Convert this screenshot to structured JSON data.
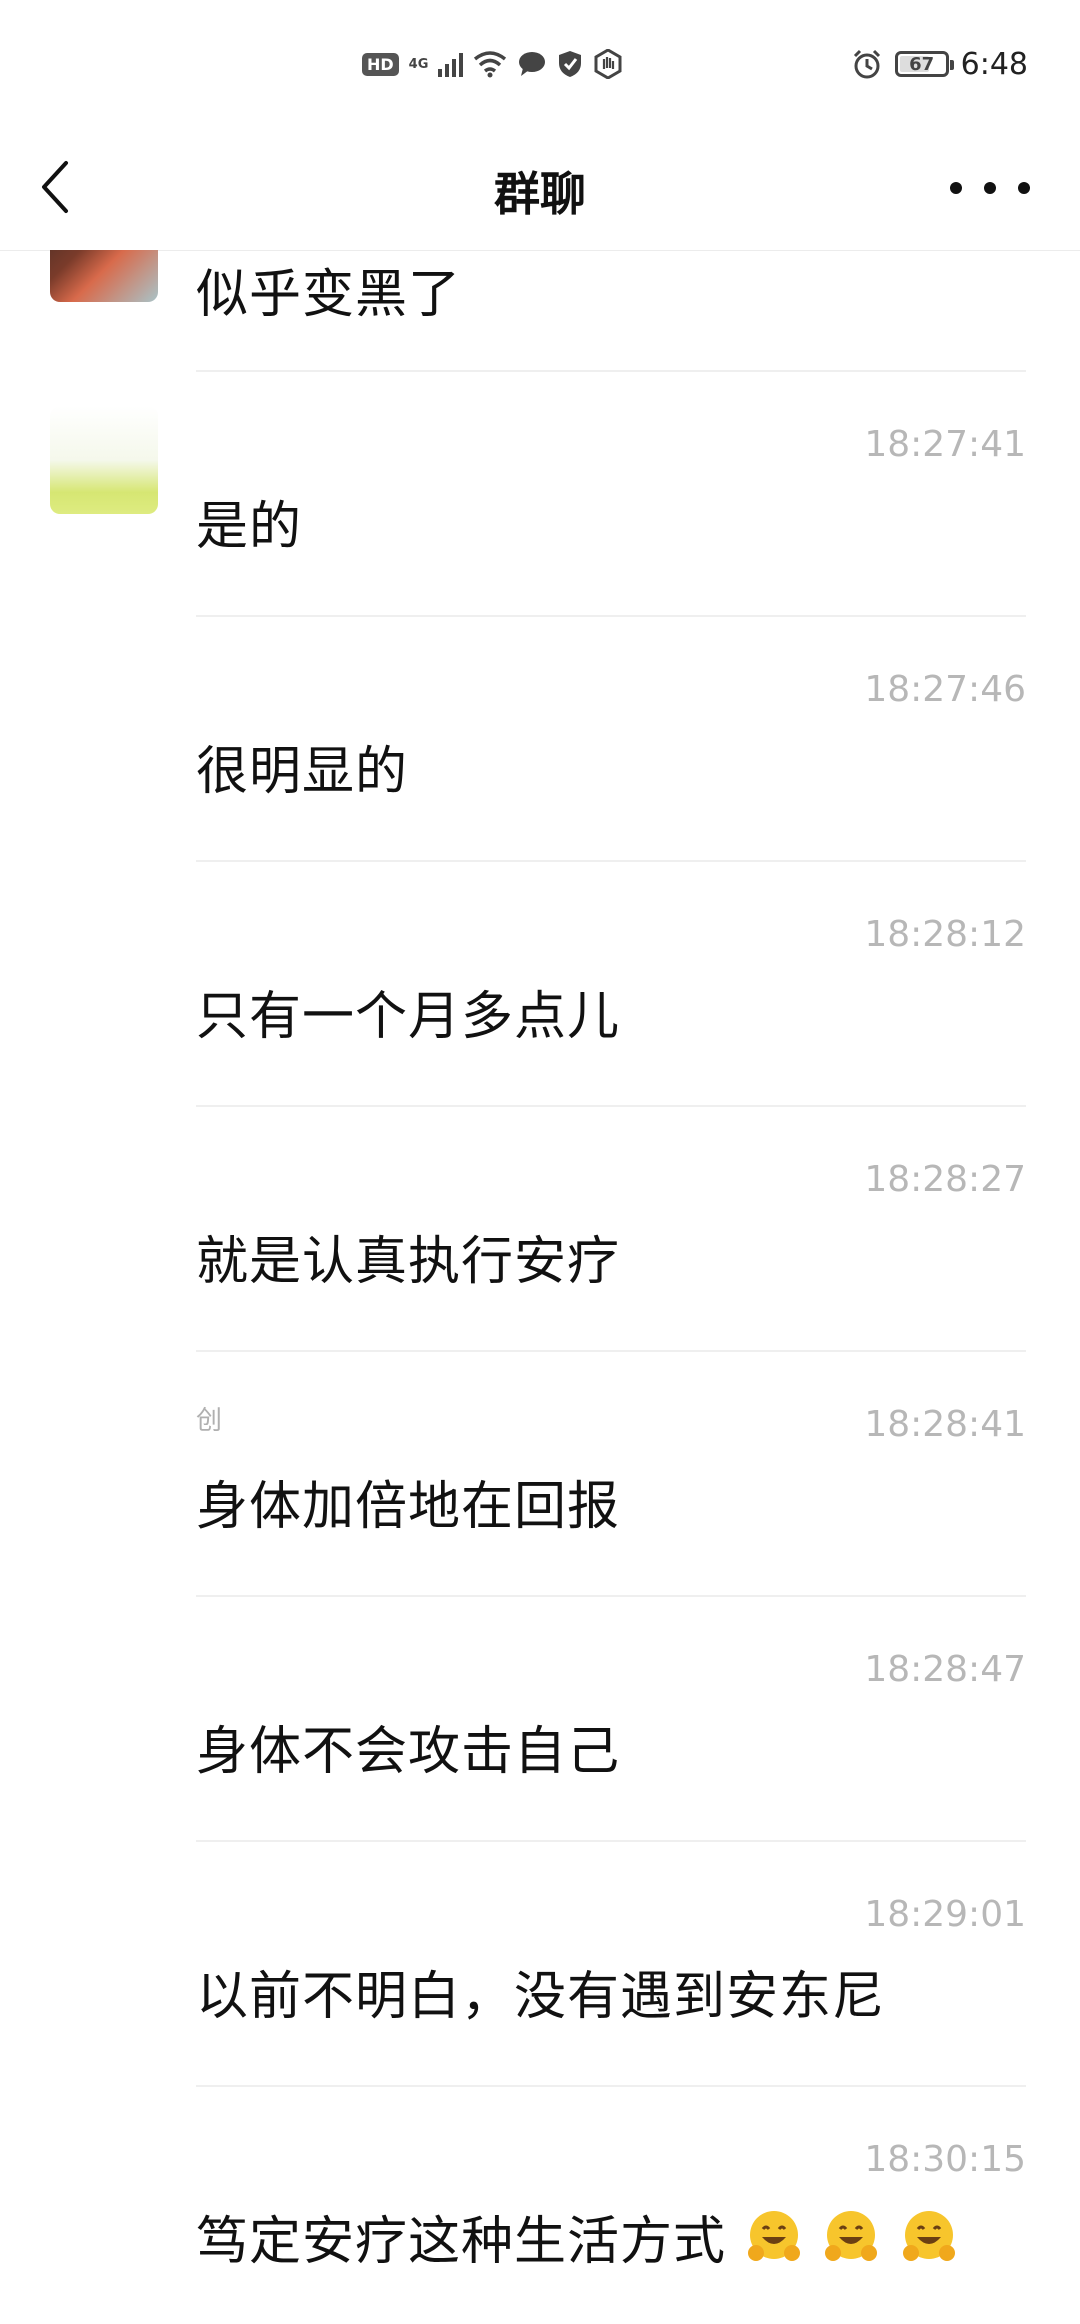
{
  "status_bar": {
    "hd": "HD",
    "net": "4G",
    "battery": "67",
    "battery_level": 0.67,
    "time": "6:48"
  },
  "header": {
    "title": "群聊"
  },
  "messages": [
    {
      "sender": "",
      "time": "",
      "text": "似乎变黑了"
    },
    {
      "sender": "",
      "time": "18:27:41",
      "text": "是的"
    },
    {
      "sender": "",
      "time": "18:27:46",
      "text": "很明显的"
    },
    {
      "sender": "",
      "time": "18:28:12",
      "text": "只有一个月多点儿"
    },
    {
      "sender": "",
      "time": "18:28:27",
      "text": "就是认真执行安疗"
    },
    {
      "sender": "创",
      "time": "18:28:41",
      "text": "身体加倍地在回报"
    },
    {
      "sender": "",
      "time": "18:28:47",
      "text": "身体不会攻击自己"
    },
    {
      "sender": "",
      "time": "18:29:01",
      "text": "以前不明白，没有遇到安东尼"
    },
    {
      "sender": "",
      "time": "18:30:15",
      "text": "笃定安疗这种生活方式"
    }
  ]
}
